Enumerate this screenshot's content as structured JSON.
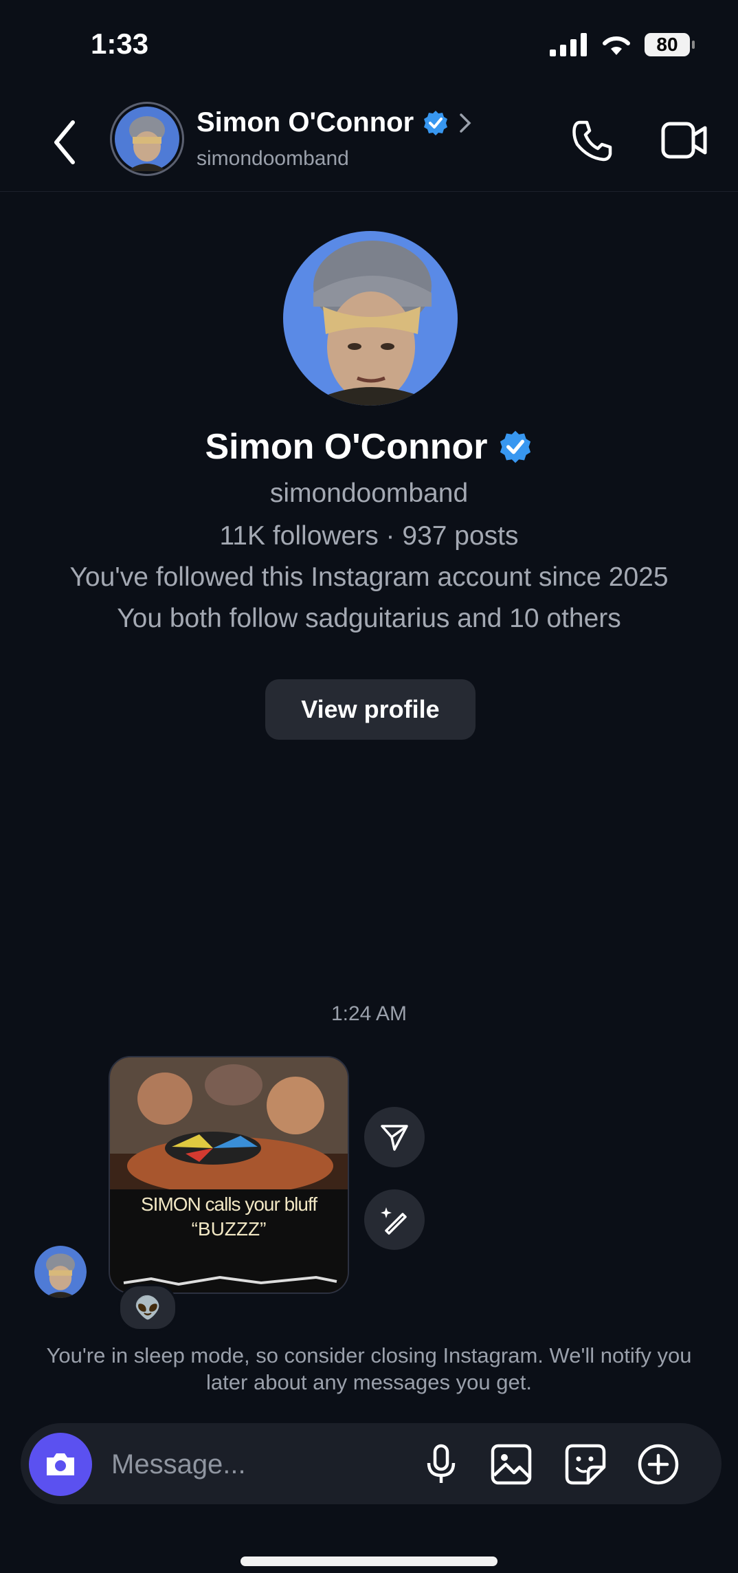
{
  "status_bar": {
    "time": "1:33",
    "battery": "80",
    "icons": [
      "cellular-signal-icon",
      "wifi-icon",
      "battery-icon"
    ]
  },
  "header": {
    "name": "Simon O'Connor",
    "username": "simondoomband",
    "icons": [
      "back-chevron-icon",
      "verified-badge-icon",
      "chevron-right-icon",
      "phone-icon",
      "video-camera-icon"
    ]
  },
  "profile": {
    "name": "Simon O'Connor",
    "username": "simondoomband",
    "stats": "11K followers · 937 posts",
    "followed_since": "You've followed this Instagram account since 2025",
    "mutuals": "You both follow sadguitarius and 10 others",
    "view_profile_label": "View profile"
  },
  "thread": {
    "timestamp": "1:24 AM",
    "post_caption_line1": "SIMON calls your bluff",
    "post_caption_line2": "“BUZZZ”",
    "reaction_emoji": "👽",
    "side_actions": [
      "share-icon",
      "ai-edit-icon"
    ]
  },
  "sleep_notice": "You're in sleep mode, so consider closing Instagram. We'll notify you later about any messages you get.",
  "composer": {
    "placeholder": "Message...",
    "icons": [
      "camera-icon",
      "microphone-icon",
      "gallery-icon",
      "sticker-icon",
      "plus-icon"
    ]
  },
  "colors": {
    "background": "#0b0f17",
    "camera_button": "#5b51f0",
    "verified": "#3897f0",
    "secondary_text": "#9aa0ab"
  }
}
